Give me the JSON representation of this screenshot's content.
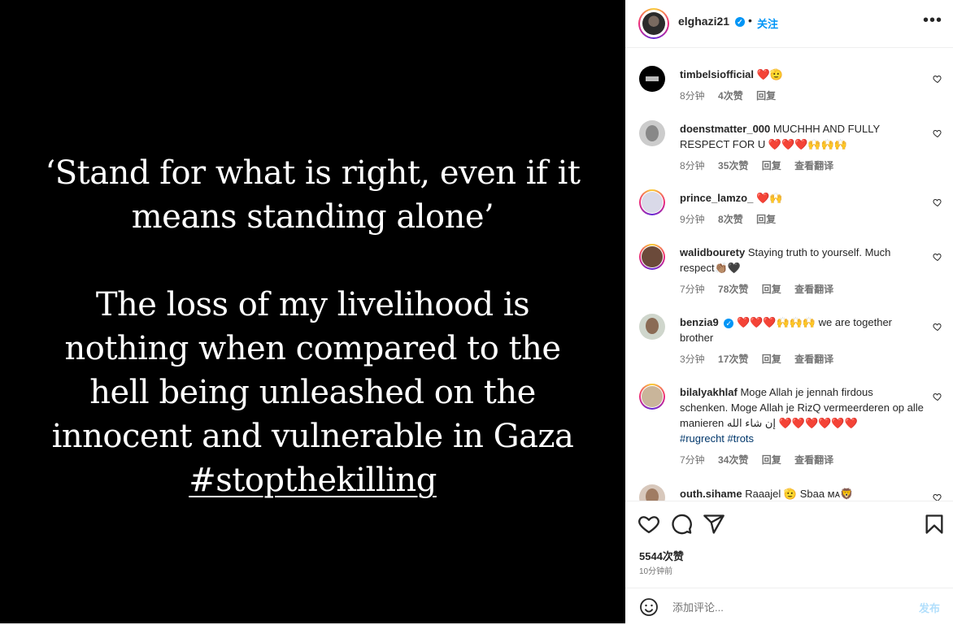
{
  "media": {
    "quote_lines_1": [
      "‘Stand for what is right, even if it",
      "means standing alone’"
    ],
    "quote_lines_2": [
      "The loss of my livelihood is",
      "nothing when compared to the",
      "hell being unleashed on the",
      "innocent and vulnerable in Gaza"
    ],
    "hashtag": "#stopthekilling"
  },
  "header": {
    "username": "elghazi21",
    "verified_glyph": "✓",
    "dot": "•",
    "follow_label": "关注",
    "more_label": "•••"
  },
  "comments": [
    {
      "user": "timbelsiofficial",
      "text": "❤️🫡",
      "time": "8分钟",
      "likes": "4次赞",
      "reply": "回复",
      "translate": ""
    },
    {
      "user": "doenstmatter_000",
      "text": "MUCHHH AND FULLY RESPECT FOR U ❤️❤️❤️🙌🙌🙌",
      "time": "8分钟",
      "likes": "35次赞",
      "reply": "回复",
      "translate": "查看翻译"
    },
    {
      "user": "prince_lamzo_",
      "text": "❤️🙌",
      "time": "9分钟",
      "likes": "8次赞",
      "reply": "回复",
      "translate": ""
    },
    {
      "user": "walidbourety",
      "text": "Staying truth to yourself. Much respect👏🏽🖤",
      "time": "7分钟",
      "likes": "78次赞",
      "reply": "回复",
      "translate": "查看翻译"
    },
    {
      "user": "benzia9",
      "text": "❤️❤️❤️🙌🙌🙌 we are together brother",
      "time": "3分钟",
      "likes": "17次赞",
      "reply": "回复",
      "translate": "查看翻译",
      "verified": "✓"
    },
    {
      "user": "bilalyakhlaf",
      "text": "Moge Allah je jennah firdous schenken. Moge Allah je RizQ vermeerderen op alle manieren إن شاء الله ❤️❤️❤️❤️❤️❤️",
      "hashtags": "#rugrecht #trots",
      "time": "7分钟",
      "likes": "34次赞",
      "reply": "回复",
      "translate": "查看翻译"
    },
    {
      "user": "outh.sihame",
      "text": "Raaajel 🫡 Sbaa ᴍᴀ🦁",
      "time": "",
      "likes": "",
      "reply": "",
      "translate": ""
    }
  ],
  "actions": {
    "likes_count": "5544次赞",
    "posted_time": "10分钟前",
    "comment_placeholder": "添加评论...",
    "post_label": "发布"
  },
  "icons": [
    "heart-icon",
    "comment-icon",
    "share-icon",
    "bookmark-icon",
    "emoji-icon",
    "more-icon",
    "verified-icon"
  ],
  "colors": {
    "accent": "#0095f6",
    "hashtag": "#00376b",
    "muted": "#737373",
    "post_disabled": "#b2dffc"
  }
}
